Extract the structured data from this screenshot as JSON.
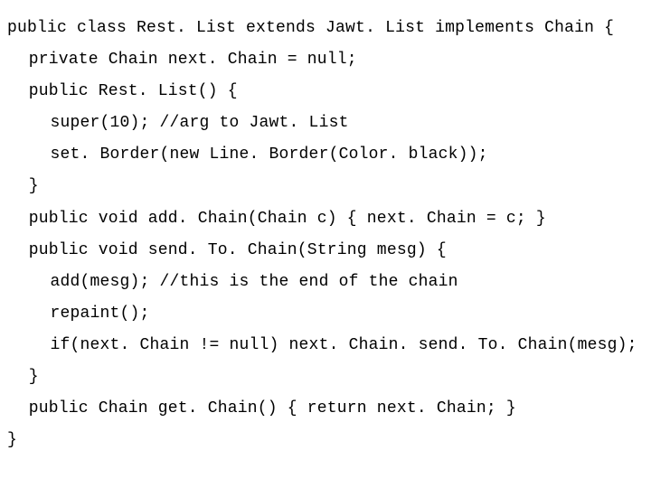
{
  "code": {
    "l1": "public class Rest. List extends Jawt. List implements Chain {",
    "l2": "private Chain next. Chain = null;",
    "l3": "public Rest. List() {",
    "l4": "super(10); //arg to Jawt. List",
    "l5": "set. Border(new Line. Border(Color. black));",
    "l6": "}",
    "l7": "public void add. Chain(Chain c) { next. Chain = c; }",
    "l8": "public void send. To. Chain(String mesg) {",
    "l9": "add(mesg); //this is the end of the chain",
    "l10": "repaint();",
    "l11": "if(next. Chain != null) next. Chain. send. To. Chain(mesg);",
    "l12": "}",
    "l13": "public Chain get. Chain() { return next. Chain; }",
    "l14": "}"
  }
}
